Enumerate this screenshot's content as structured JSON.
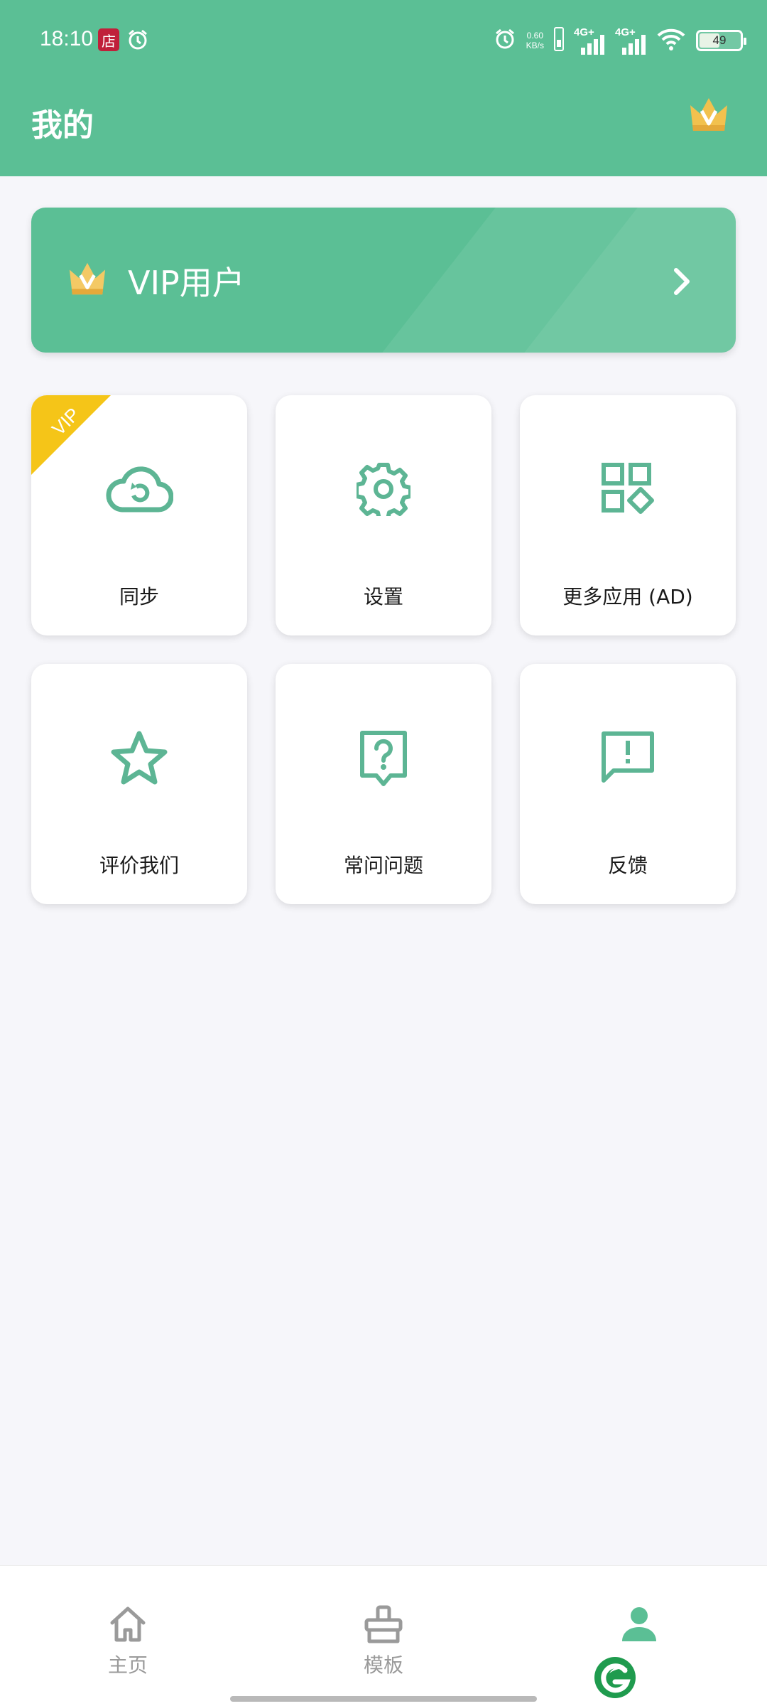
{
  "status_bar": {
    "time": "18:10",
    "badge": "店",
    "net_speed_value": "0.60",
    "net_speed_unit": "KB/s",
    "signal_1": "4G+",
    "signal_2": "4G+",
    "battery": "49"
  },
  "header": {
    "title": "我的",
    "crown_icon": "vip-crown-icon"
  },
  "vip_banner": {
    "label": "VIP用户",
    "icon": "vip-crown-icon",
    "chevron": "chevron-right-icon"
  },
  "grid": [
    {
      "label": "同步",
      "icon": "cloud-sync-icon",
      "vip_badge": "VIP"
    },
    {
      "label": "设置",
      "icon": "gear-icon"
    },
    {
      "label": "更多应用 (AD)",
      "icon": "apps-grid-icon"
    },
    {
      "label": "评价我们",
      "icon": "star-icon"
    },
    {
      "label": "常问问题",
      "icon": "help-question-icon"
    },
    {
      "label": "反馈",
      "icon": "feedback-icon"
    }
  ],
  "tabbar": {
    "tabs": [
      {
        "label": "主页",
        "icon": "home-icon",
        "active": false
      },
      {
        "label": "模板",
        "icon": "template-icon",
        "active": false
      },
      {
        "label": "",
        "icon": "profile-icon",
        "active": true
      }
    ]
  },
  "colors": {
    "primary": "#5bbf95",
    "icon": "#5db594",
    "gold": "#f2c14e",
    "ribbon": "#f5c518",
    "tab_inactive": "#9a9a9a"
  }
}
